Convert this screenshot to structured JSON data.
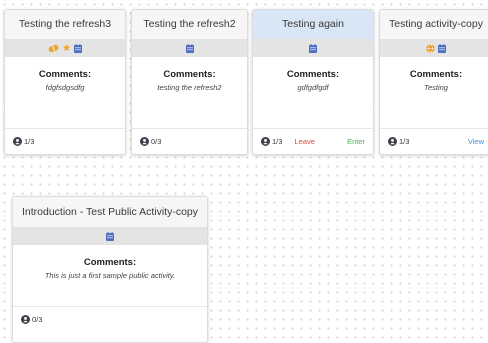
{
  "cards": [
    {
      "title": "Testing the refresh3",
      "icons": [
        "pill-icon",
        "star-icon",
        "calendar-icon"
      ],
      "comments_label": "Comments:",
      "comments_text": "fdgfsdgsdfg",
      "count": "1/3",
      "actions": []
    },
    {
      "title": "Testing the refresh2",
      "icons": [
        "calendar-icon"
      ],
      "comments_label": "Comments:",
      "comments_text": "testing the refresh2",
      "count": "0/3",
      "actions": []
    },
    {
      "title": "Testing again",
      "icons": [
        "calendar-icon"
      ],
      "comments_label": "Comments:",
      "comments_text": "gdfgdfgdf",
      "count": "1/3",
      "actions": [
        "Leave",
        "Enter"
      ]
    },
    {
      "title": "Testing activity-copy",
      "icons": [
        "globe-icon",
        "calendar-icon"
      ],
      "comments_label": "Comments:",
      "comments_text": "Testing",
      "count": "1/3",
      "actions": [
        "View"
      ]
    },
    {
      "title": "Introduction - Test Public Activity-copy",
      "icons": [
        "calendar-icon"
      ],
      "comments_label": "Comments:",
      "comments_text": "This is just a first sample public activity.",
      "count": "0/3",
      "actions": []
    }
  ],
  "colors": {
    "calendar": "#4f6fc2",
    "star": "#f2a21b",
    "pill": "#e8a73a",
    "globe": "#e9962a",
    "active_header": "#d8e6f5",
    "leave": "#e0463c",
    "enter": "#4caf50",
    "view": "#3d8fe0"
  }
}
